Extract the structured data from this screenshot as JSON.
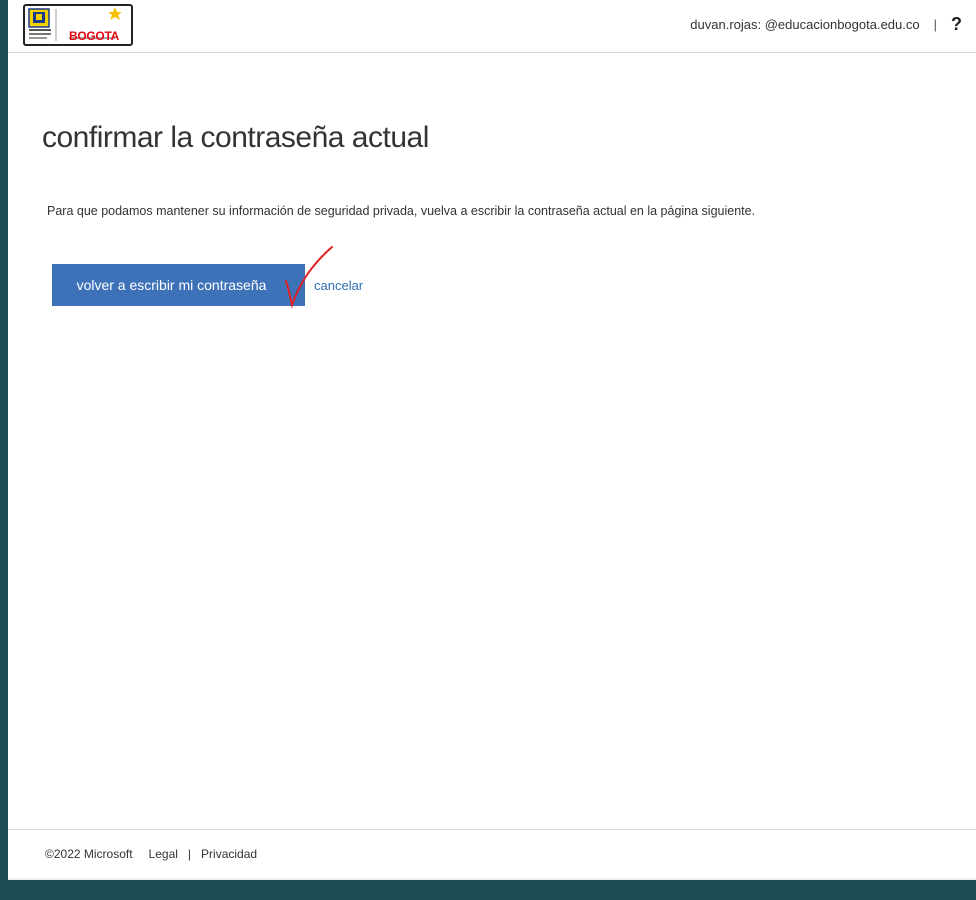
{
  "header": {
    "logo_text": "BOGOTA",
    "user_email": "duvan.rojas: @educacionbogota.edu.co",
    "separator": "|",
    "help_label": "?"
  },
  "main": {
    "title": "confirmar la contraseña actual",
    "description": "Para que podamos mantener su información de seguridad privada, vuelva a escribir la contraseña actual en la página siguiente.",
    "primary_button": "volver a escribir mi contraseña",
    "cancel_link": "cancelar"
  },
  "footer": {
    "copyright": "©2022 Microsoft",
    "legal": "Legal",
    "separator": "|",
    "privacy": "Privacidad"
  },
  "colors": {
    "button": "#3d72b8",
    "link": "#2f6fb5",
    "annotation": "#e02020"
  }
}
